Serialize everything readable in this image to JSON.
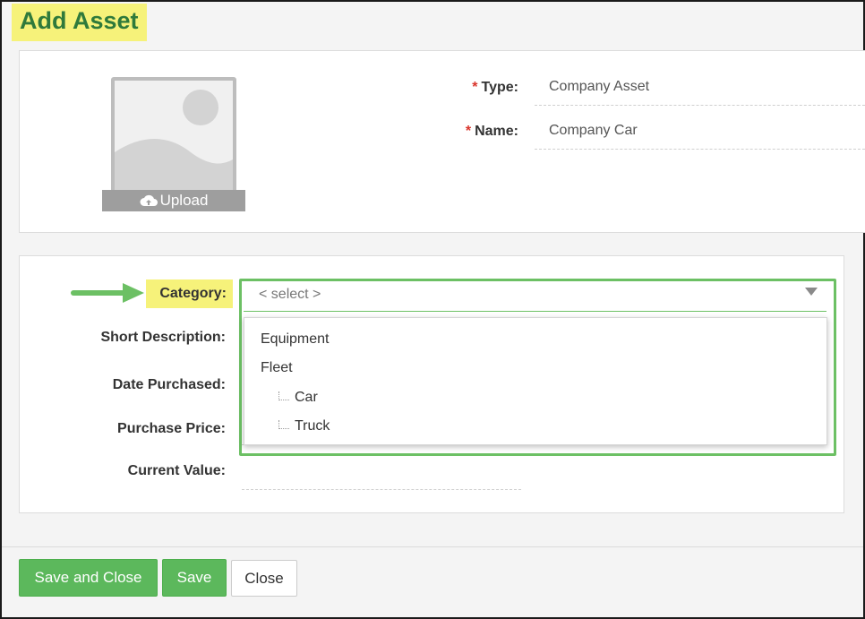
{
  "page": {
    "title": "Add Asset"
  },
  "photo": {
    "upload_label": "Upload",
    "icon": "cloud-upload-icon"
  },
  "fields": {
    "type": {
      "required_mark": "*",
      "label": "Type:",
      "value": "Company Asset"
    },
    "name": {
      "required_mark": "*",
      "label": "Name:",
      "value": "Company Car"
    },
    "category": {
      "label": "Category:",
      "placeholder": "< select >"
    },
    "short_description": {
      "label": "Short Description:"
    },
    "date_purchased": {
      "label": "Date Purchased:"
    },
    "purchase_price": {
      "label": "Purchase Price:"
    },
    "current_value": {
      "label": "Current Value:"
    }
  },
  "category_options": [
    {
      "label": "Equipment",
      "level": 0
    },
    {
      "label": "Fleet",
      "level": 0
    },
    {
      "label": "Car",
      "level": 1
    },
    {
      "label": "Truck",
      "level": 1
    }
  ],
  "buttons": {
    "save_and_close": "Save and Close",
    "save": "Save",
    "close": "Close"
  },
  "colors": {
    "title_green": "#2f7a3b",
    "highlight_yellow": "#f6f27a",
    "accent_green": "#5cb85c",
    "required_red": "#d9342b"
  }
}
